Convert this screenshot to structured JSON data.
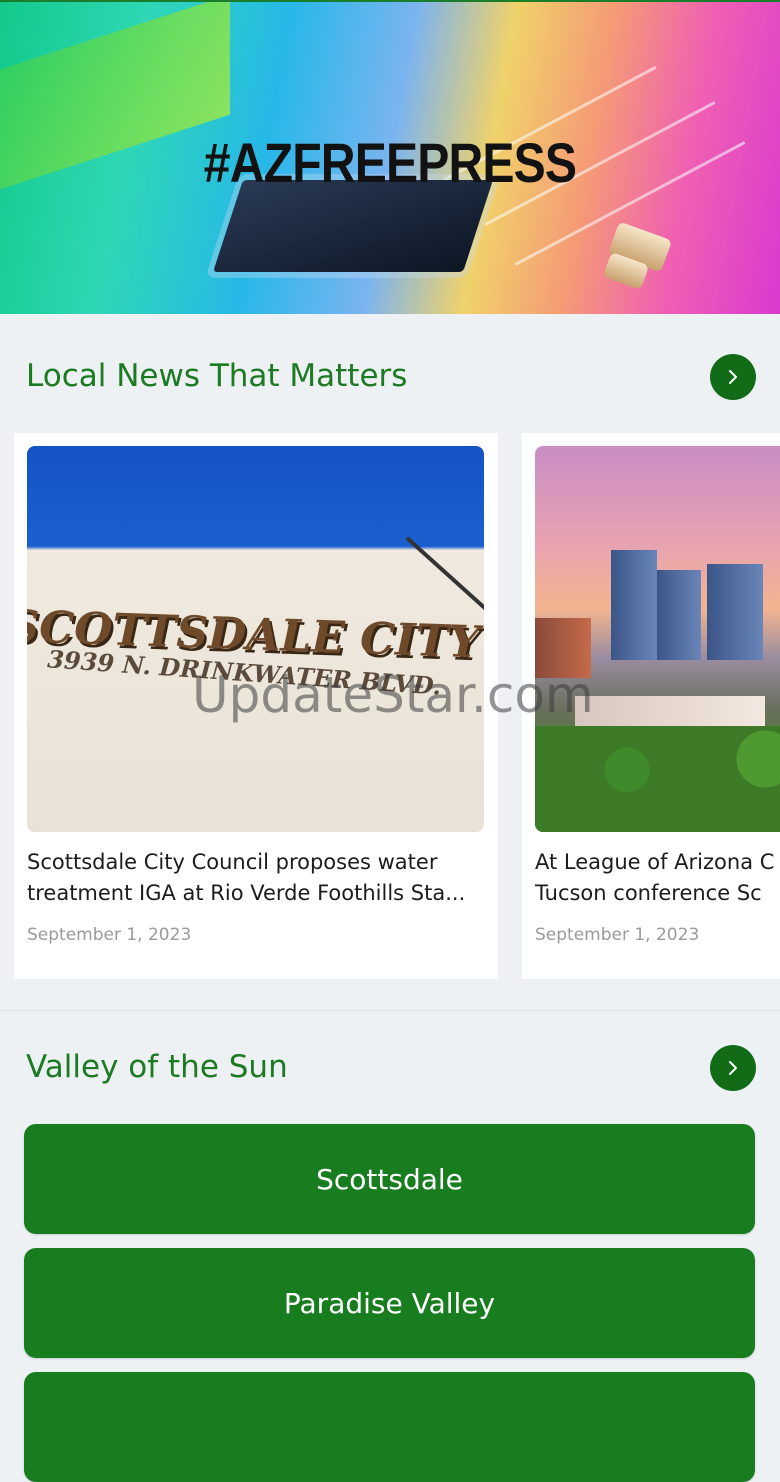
{
  "hero": {
    "title": "#AZFREEPRESS"
  },
  "sections": [
    {
      "title": "Local News That Matters",
      "arrow_icon": "chevron-right-icon"
    },
    {
      "title": "Valley of the Sun",
      "arrow_icon": "chevron-right-icon"
    }
  ],
  "articles": [
    {
      "headline_line1": "Scottsdale City Council proposes water",
      "headline_line2": "treatment IGA at Rio Verde Foothills Sta...",
      "date": "September 1, 2023",
      "image_text": "SCOTTSDALE CITY HALL",
      "image_subtext": "3939 N. DRINKWATER BLVD."
    },
    {
      "headline_line1": "At League of Arizona C",
      "headline_line2": "Tucson conference Sc",
      "date": "September 1, 2023"
    }
  ],
  "cities": [
    "Scottsdale",
    "Paradise Valley"
  ],
  "watermark": "UpdateStar.com",
  "colors": {
    "brand_green": "#177d1f",
    "title_green": "#1b7a22",
    "arrow_bg": "#116b17",
    "background": "#eef1f4"
  }
}
